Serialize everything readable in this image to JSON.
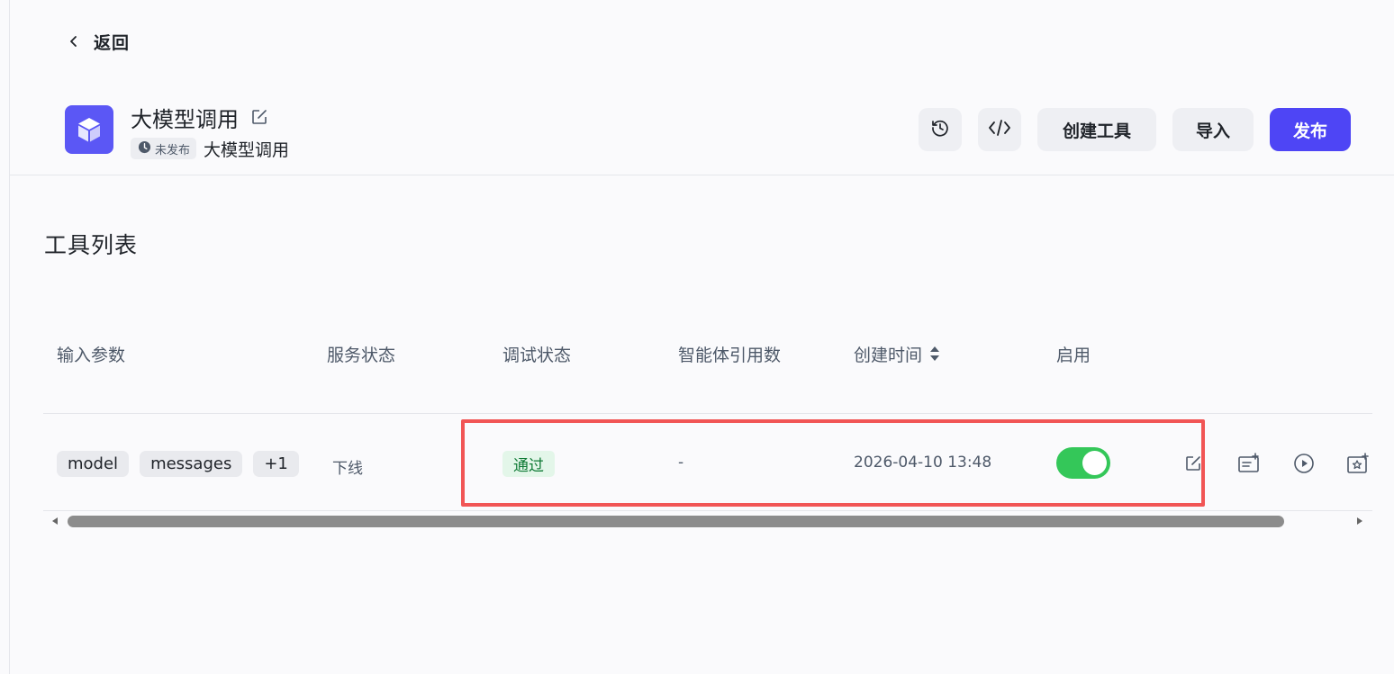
{
  "nav": {
    "back_label": "返回"
  },
  "header": {
    "title": "大模型调用",
    "status": "未发布",
    "description": "大模型调用",
    "actions": {
      "history_icon": "history-icon",
      "code_icon": "code-icon",
      "create_tool": "创建工具",
      "import": "导入",
      "publish": "发布"
    }
  },
  "section": {
    "title": "工具列表"
  },
  "table": {
    "columns": {
      "params": "输入参数",
      "service_status": "服务状态",
      "debug_status": "调试状态",
      "agent_refs": "智能体引用数",
      "created_at": "创建时间",
      "enabled": "启用"
    },
    "rows": [
      {
        "params": [
          "model",
          "messages",
          "+1"
        ],
        "service_status": "下线",
        "debug_status": "通过",
        "agent_refs": "-",
        "created_at": "2026-04-10 13:48",
        "enabled": true
      }
    ]
  },
  "colors": {
    "accent": "#4e45f5",
    "toggle_on": "#34c759",
    "highlight": "#f15555"
  }
}
